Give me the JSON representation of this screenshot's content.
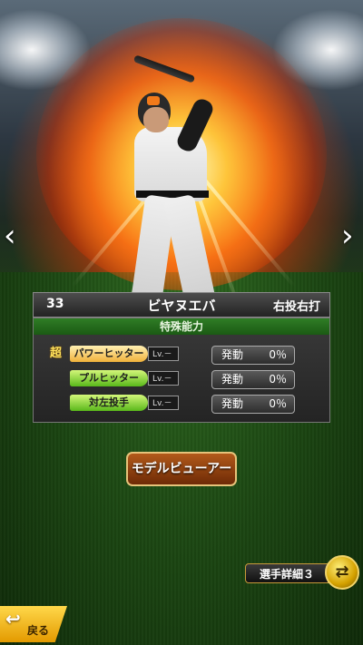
{
  "player": {
    "number": "33",
    "name": "ビヤヌエバ",
    "handedness": "右投右打"
  },
  "abilities": {
    "header": "特殊能力",
    "items": [
      {
        "prefix": "超",
        "name": "パワーヒッター",
        "level": "Lv.－",
        "status": "発動",
        "percent": "0％",
        "style": "gold"
      },
      {
        "prefix": "",
        "name": "プルヒッター",
        "level": "Lv.－",
        "status": "発動",
        "percent": "0％",
        "style": "green"
      },
      {
        "prefix": "",
        "name": "対左投手",
        "level": "Lv.－",
        "status": "発動",
        "percent": "0％",
        "style": "green"
      }
    ]
  },
  "buttons": {
    "model_viewer": "モデルビューアー",
    "player_detail": "選手詳細３",
    "back": "戻る"
  },
  "icons": {
    "prev": "chevron-left-icon",
    "next": "chevron-right-icon",
    "cycle": "cycle-icon"
  }
}
